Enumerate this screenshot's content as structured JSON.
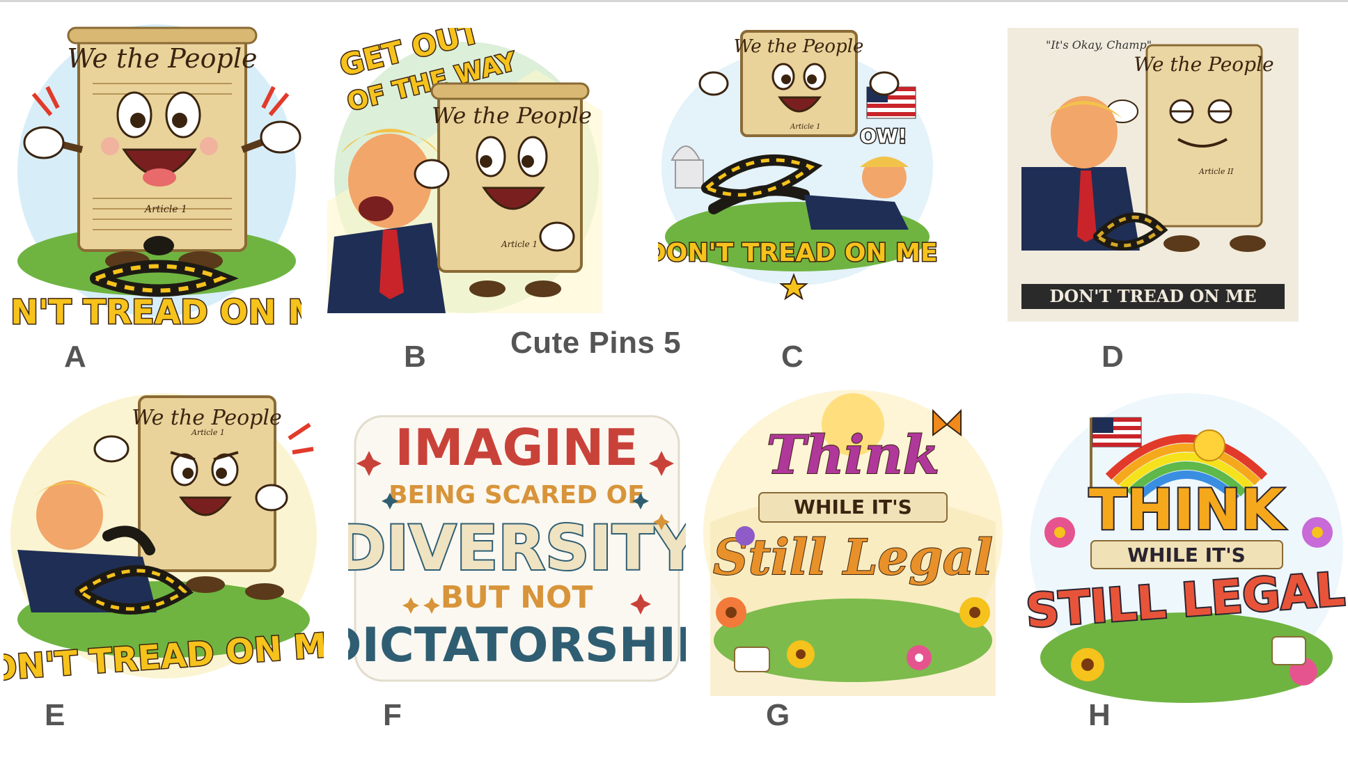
{
  "page": {
    "title": "Cute Pins 5"
  },
  "tiles": {
    "a": {
      "letter": "A",
      "heading": "We the People",
      "article": "Article 1",
      "slogan": "DON'T TREAD ON ME!"
    },
    "b": {
      "letter": "B",
      "banner_line1": "GET OUT",
      "banner_line2": "OF THE WAY",
      "heading": "We the People",
      "article": "Article 1"
    },
    "c": {
      "letter": "C",
      "heading": "We the People",
      "article": "Article 1",
      "exclaim": "OW!",
      "slogan": "DON'T TREAD ON ME!"
    },
    "d": {
      "letter": "D",
      "quote": "\"It's Okay, Champ\"",
      "heading": "We the People",
      "article": "Article II",
      "slogan": "DON'T TREAD ON ME"
    },
    "e": {
      "letter": "E",
      "heading": "We the People",
      "article": "Article 1",
      "slogan": "DON'T TREAD ON ME!"
    },
    "f": {
      "letter": "F",
      "line1": "IMAGINE",
      "line2": "BEING SCARED OF",
      "line3": "DIVERSITY",
      "line4": "BUT NOT",
      "line5": "DICTATORSHIP"
    },
    "g": {
      "letter": "G",
      "line1": "Think",
      "line2": "WHILE IT'S",
      "line3": "Still Legal"
    },
    "h": {
      "letter": "H",
      "line1": "THINK",
      "line2": "WHILE IT'S",
      "line3": "STILL LEGAL"
    }
  },
  "colors": {
    "parchment": "#e9d39a",
    "parchment_dark": "#c9a862",
    "slogan_yellow": "#f6c21c",
    "slogan_outline": "#3a2410",
    "snake_black": "#1d1a14",
    "grass": "#5fa83a",
    "sky": "#bfe3f7",
    "suit_navy": "#1f2e55",
    "tie_red": "#c8242a",
    "hair_blond": "#f2c34a",
    "label_gray": "#555555",
    "f_red": "#c9423a",
    "f_gold": "#d8943a",
    "f_cream": "#efe3c2",
    "f_teal": "#2f5e73"
  },
  "icons": {
    "a": "constitution-mascot-illustration",
    "b": "constitution-pushing-man-illustration",
    "c": "constitution-snake-illustration",
    "d": "constitution-patting-head-illustration",
    "e": "constitution-snake-bite-illustration",
    "f": "typographic-sticker",
    "g": "floral-lettering-illustration",
    "h": "rainbow-lettering-illustration"
  }
}
